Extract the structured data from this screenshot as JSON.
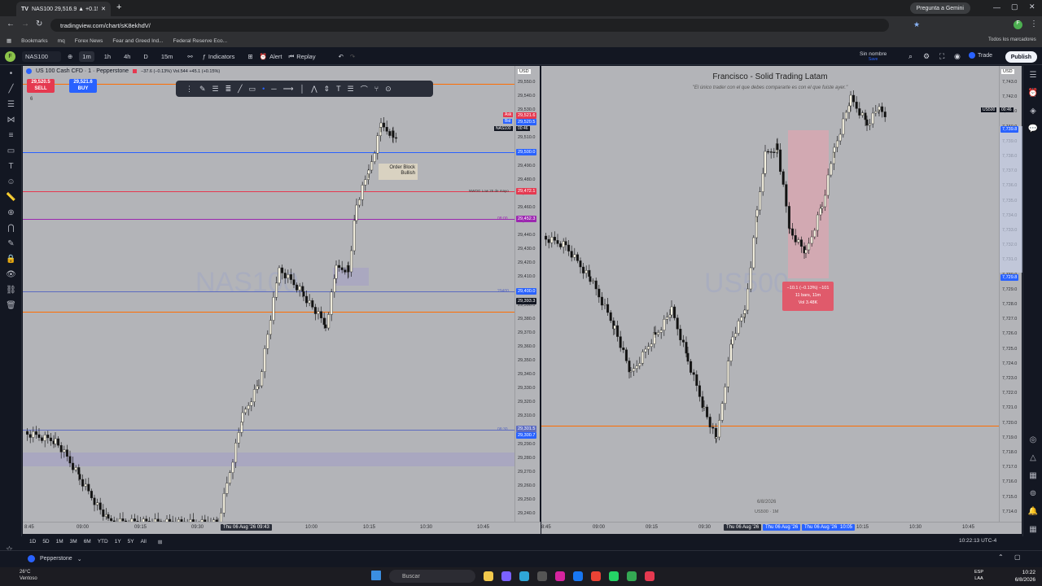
{
  "browser": {
    "tab_title": "NAS100 29,516.9 ▲ +0.15% Sin",
    "new_tab": "+",
    "url": "tradingview.com/chart/sK8ekhdV/",
    "gemini_button": "Pregunta a Gemini",
    "bookmarks": [
      "Bookmarks",
      "mq",
      "Forex News",
      "Fear and Greed Ind...",
      "Federal Reserve Eco..."
    ],
    "all_bookmarks": "Todos los marcadores"
  },
  "tv_toolbar": {
    "symbol": "NAS100",
    "intervals": [
      "1m",
      "1h",
      "4h",
      "D",
      "15m"
    ],
    "indicators": "Indicators",
    "alert": "Alert",
    "replay": "Replay",
    "layout_name": "Sin nombre",
    "layout_sub": "Save",
    "trade": "Trade",
    "publish": "Publish"
  },
  "left_chart": {
    "legend": "US 100 Cash CFD · 1 · Pepperstone",
    "legend_change": "−37.6 (−0.13%) Vol.544 +45.1 (+0.15%)",
    "sell_price": "29,520.5",
    "sell_label": "SELL",
    "buy_price": "29,521.6",
    "buy_label": "BUY",
    "indicator_count": "6",
    "watermark": "NAS100",
    "currency": "USD",
    "order_block_label": "Order Block\nBullish",
    "nwog_label": "NWOG Low 25 de mayo",
    "label_0800": "08:00",
    "label_29400": "29400",
    "label_0830": "08:30",
    "ask_label": "Ask",
    "bid_label": "Bid",
    "price_ticks": [
      "29,550.0",
      "29,540.0",
      "29,530.0",
      "29,520.0",
      "29,510.0",
      "29,500.0",
      "29,490.0",
      "29,480.0",
      "29,470.0",
      "29,460.0",
      "29,450.0",
      "29,440.0",
      "29,430.0",
      "29,420.0",
      "29,410.0",
      "29,400.0",
      "29,390.0",
      "29,380.0",
      "29,370.0",
      "29,360.0",
      "29,350.0",
      "29,340.0",
      "29,330.0",
      "29,320.0",
      "29,310.0",
      "29,300.0",
      "29,290.0",
      "29,280.0",
      "29,270.0",
      "29,260.0",
      "29,250.0",
      "29,240.0"
    ],
    "badges": {
      "ask": "29,521.6",
      "bid": "29,520.5",
      "symbol": "NAS100",
      "countdown": "00:46",
      "level_29500": "29,500.0",
      "level_nwog": "29,472.1",
      "level_0800": "29,452.3",
      "level_29400": "29,400.0",
      "crosshair": "29,393.3",
      "level_0830a": "29,301.5",
      "level_0830b": "29,300.7"
    },
    "time_ticks": [
      "8:45",
      "09:00",
      "09:15",
      "09:30",
      "10:00",
      "10:15",
      "10:30",
      "10:45"
    ],
    "time_highlight": "Thu 06 Aug '26  09:43"
  },
  "right_chart": {
    "title": "Francisco - Solid Trading Latam",
    "quote": "\"El único trader con el que debes compararte es con el que fuiste ayer.\"",
    "watermark": "US500",
    "currency": "USD",
    "symbol_badge": "US500",
    "countdown": "00:46",
    "date_label": "6/8/2026",
    "sub_label": "US500 · 1M",
    "range_box": [
      "−10.1 (−0.13%) −101",
      "11 bars, 11m",
      "Vol 3.48K"
    ],
    "price_ticks": [
      "7,743.0",
      "7,742.0",
      "7,741.0",
      "7,740.0",
      "7,739.0",
      "7,738.0",
      "7,737.0",
      "7,736.0",
      "7,735.0",
      "7,734.0",
      "7,733.0",
      "7,732.0",
      "7,731.0",
      "7,730.0",
      "7,729.0",
      "7,728.0",
      "7,727.0",
      "7,726.0",
      "7,725.0",
      "7,724.0",
      "7,723.0",
      "7,722.0",
      "7,721.0",
      "7,720.0",
      "7,719.0",
      "7,718.0",
      "7,717.0",
      "7,716.0",
      "7,715.0",
      "7,714.0"
    ],
    "badge_top": "7,739.8",
    "badge_mid": "7,729.8",
    "time_ticks": [
      "8:45",
      "09:00",
      "09:15",
      "09:30",
      "10:15",
      "10:30",
      "10:45"
    ],
    "time_highlights": [
      "Thu 06 Aug '26",
      "Thu 06 Aug '26",
      "Thu 06 Aug '26",
      "10:05"
    ],
    "clock": "10:22:13 UTC-4"
  },
  "bottom_bar": {
    "ranges": [
      "1D",
      "5D",
      "1M",
      "3M",
      "6M",
      "YTD",
      "1Y",
      "5Y",
      "All"
    ],
    "broker": "Pepperstone"
  },
  "taskbar": {
    "weather_temp": "26°C",
    "weather_desc": "Ventoso",
    "search": "Buscar",
    "lang": "ESP",
    "lang_sub": "LAA",
    "time": "10:22",
    "date": "6/8/2026"
  },
  "colors": {
    "blue_line": "#2962ff",
    "red_line": "#e53950",
    "purple_line": "#9c27b0",
    "orange_line": "#ff6d00",
    "candle_up": "#f5f1e0",
    "candle_down": "#111111"
  }
}
